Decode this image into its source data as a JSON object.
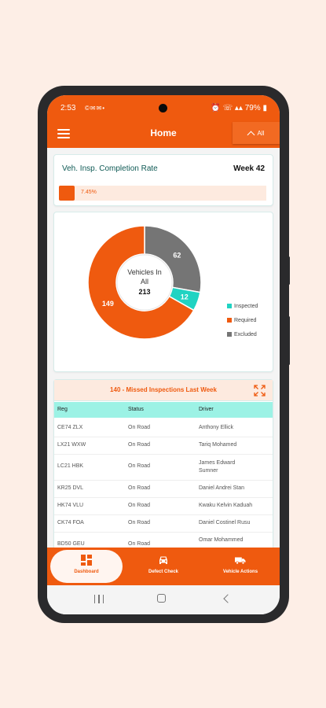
{
  "status_bar": {
    "time": "2:53",
    "notification_icons": "©✉✉•",
    "right_icons": "⏰ ☏ ▴▴",
    "battery": "79%"
  },
  "app_bar": {
    "title": "Home",
    "filter_label": "All"
  },
  "completion": {
    "title": "Veh. Insp. Completion Rate",
    "week": "Week 42",
    "rate_label": "7.45%",
    "rate_value": 0.0745
  },
  "donut": {
    "center_line1": "Vehicles In",
    "center_line2": "All",
    "total": "213",
    "segments": [
      {
        "name": "Inspected",
        "value": 12,
        "label": "12",
        "color": "#20d3c2"
      },
      {
        "name": "Required",
        "value": 149,
        "label": "149",
        "color": "#ef5a0f"
      },
      {
        "name": "Excluded",
        "value": 62,
        "label": "62",
        "color": "#757575"
      }
    ]
  },
  "chart_data": {
    "type": "pie",
    "categories": [
      "Inspected",
      "Required",
      "Excluded"
    ],
    "values": [
      12,
      149,
      62
    ],
    "title": "Vehicles In All",
    "total": 213,
    "legend_position": "right"
  },
  "missed": {
    "title": "140 - Missed Inspections Last Week",
    "columns": [
      "Reg",
      "Status",
      "Driver"
    ],
    "rows": [
      {
        "reg": "CE74 ZLX",
        "status": "On Road",
        "driver": "Anthony Ellick"
      },
      {
        "reg": "LX21 WXW",
        "status": "On Road",
        "driver": "Tariq Mohamed"
      },
      {
        "reg": "LC21 HBK",
        "status": "On Road",
        "driver": "James Edward Sumner"
      },
      {
        "reg": "KR25 DVL",
        "status": "On Road",
        "driver": "Daniel Andrei Stan"
      },
      {
        "reg": "HK74 VLU",
        "status": "On Road",
        "driver": "Kwaku Kelvin Kaduah"
      },
      {
        "reg": "CK74 FOA",
        "status": "On Road",
        "driver": "Daniel Costinel Rusu"
      },
      {
        "reg": "BD50 GEU",
        "status": "On Road",
        "driver": "Omar Mohammed"
      }
    ]
  },
  "bottom_nav": [
    {
      "label": "Dashboard",
      "icon": "dashboard-icon"
    },
    {
      "label": "Defect Check",
      "icon": "car-icon"
    },
    {
      "label": "Vehicle Actions",
      "icon": "truck-icon"
    }
  ]
}
